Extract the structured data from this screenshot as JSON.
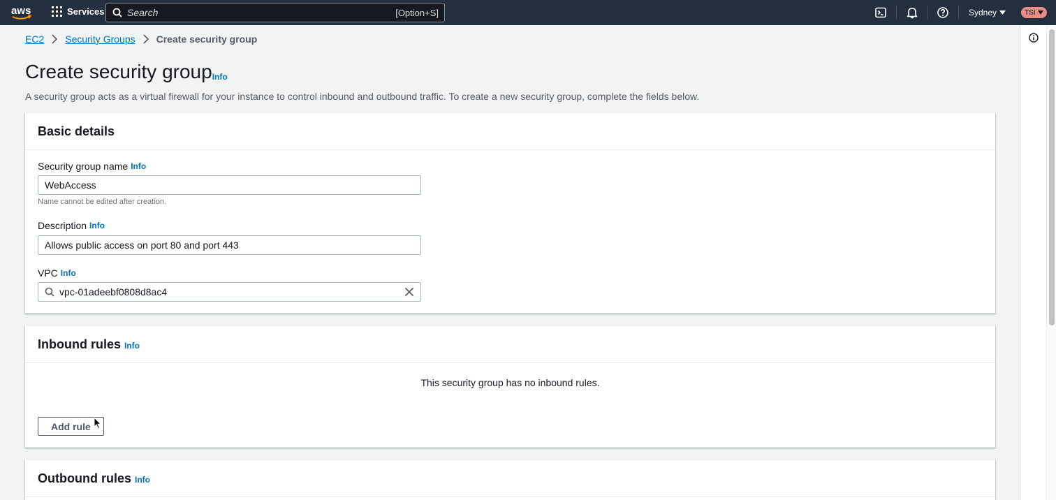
{
  "topnav": {
    "logo_text": "aws",
    "services_label": "Services",
    "search_placeholder": "Search",
    "search_shortcut": "[Option+S]",
    "region_label": "Sydney",
    "account_label": "TSI",
    "icons": [
      "cloudshell-icon",
      "notifications-icon",
      "help-icon"
    ]
  },
  "breadcrumb": {
    "items": [
      "EC2",
      "Security Groups"
    ],
    "current": "Create security group"
  },
  "page": {
    "title": "Create security group",
    "title_info": "Info",
    "description": "A security group acts as a virtual firewall for your instance to control inbound and outbound traffic. To create a new security group, complete the fields below."
  },
  "basic_details": {
    "heading": "Basic details",
    "name_label": "Security group name",
    "name_info": "Info",
    "name_value": "WebAccess",
    "name_hint": "Name cannot be edited after creation.",
    "desc_label": "Description",
    "desc_info": "Info",
    "desc_value": "Allows public access on port 80 and port 443",
    "vpc_label": "VPC",
    "vpc_info": "Info",
    "vpc_value": "vpc-01adeebf0808d8ac4"
  },
  "inbound": {
    "heading": "Inbound rules",
    "info": "Info",
    "empty_text": "This security group has no inbound rules.",
    "add_rule_label": "Add rule"
  },
  "outbound": {
    "heading": "Outbound rules",
    "info": "Info"
  },
  "colors": {
    "nav_bg": "#232f3e",
    "link": "#0073bb",
    "page_bg": "#f2f3f3"
  }
}
